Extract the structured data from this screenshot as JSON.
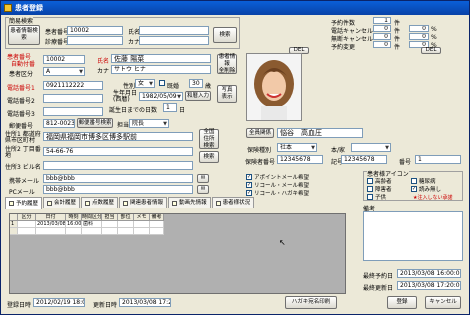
{
  "window": {
    "title": "患者登録"
  },
  "search": {
    "group_label": "簡易検索",
    "button": "患者情報検索",
    "no_label": "患者番号",
    "no_value": "10002",
    "card_label": "診療番号",
    "card_value": "",
    "name_label": "氏名",
    "name_value": "",
    "kana_label": "カナ",
    "kana_value": "",
    "search_btn": "検索"
  },
  "stats": {
    "rows": [
      {
        "label": "予約件数",
        "count": "1",
        "unit": "件"
      },
      {
        "label": "電話キャンセル",
        "count": "0",
        "unit": "件",
        "pct": "0",
        "pct_unit": "%"
      },
      {
        "label": "無断キャンセル",
        "count": "0",
        "unit": "件",
        "pct": "0",
        "pct_unit": "%"
      },
      {
        "label": "予約変更",
        "count": "0",
        "unit": "件",
        "pct": "0",
        "pct_unit": "%"
      }
    ],
    "del1": "DEL",
    "del2": "DEL"
  },
  "patient": {
    "no_label": "患者番号",
    "no_sub": "自動付番",
    "no_value": "10002",
    "div_label": "患者区分",
    "div_value": "A",
    "tel1_label": "電話番号1",
    "tel1_value": "0921112222",
    "tel2_label": "電話番号2",
    "tel2_value": "",
    "tel3_label": "電話番号3",
    "tel3_value": "",
    "zip_label": "郵便番号",
    "zip_value": "812-0023",
    "zip_btn": "郵便番号検索",
    "addr1_label": "住所1 都道府県市区町村",
    "addr1_value": "福岡県福岡市博多区博多駅前",
    "addr2_label": "住所2 丁目番地",
    "addr2_value": "54-66-76",
    "addr3_label": "住所3 ビル名",
    "addr3_value": "",
    "mobile_label": "携帯メール",
    "mobile_value": "bbb@bbb",
    "pc_label": "PCメール",
    "pc_value": "bbb@bbb",
    "name_label": "氏名",
    "name_value": "佐藤 陽菜",
    "kana_label": "カナ",
    "kana_value": "サトウ ヒナ",
    "sex_label": "性別",
    "sex_value": "女",
    "married_label": "既婚",
    "married_value": "",
    "age_value": "30",
    "age_unit": "歳",
    "birth_label": "生年月日 (西暦)",
    "birth_value": "1982/05/09",
    "birth_btn": "和暦入力",
    "days_label": "誕生日までの日数",
    "days_value": "1",
    "days_unit": "日",
    "ref_label": "担当",
    "ref_value": "院長",
    "info_btn": "患者情報\n全削除",
    "photo_btn": "写真\n表示",
    "addr_btn1": "全国\n住所\n検索",
    "addr_btn2": "検索"
  },
  "insurance": {
    "family_btn": "全員関係",
    "family_value": "悩谷　高血圧",
    "type_label": "保険種別",
    "type_value": "社本",
    "cat_label": "本/家",
    "cat_value": "",
    "num_label": "保険者番号",
    "num_value": "12345678",
    "sym_label": "記号",
    "sym_value": "12345678",
    "no_label": "番号",
    "no_value": "1"
  },
  "checks": [
    {
      "label": "アポイントメール希望",
      "checked": true
    },
    {
      "label": "リコール・メール希望",
      "checked": true
    },
    {
      "label": "リコール・ハガキ希望",
      "checked": true
    }
  ],
  "icons": {
    "label": "患者様アイコン",
    "items": [
      {
        "label": "高齢者",
        "checked": false
      },
      {
        "label": "糖尿病",
        "checked": false
      },
      {
        "label": "障害者",
        "checked": false
      },
      {
        "label": "読み無し",
        "checked": true
      },
      {
        "label": "子供",
        "checked": false
      }
    ]
  },
  "notes": {
    "label": "備考",
    "value": "",
    "warn": "★注入しない承諾"
  },
  "tabs": [
    "予約履歴",
    "会計履歴",
    "点数履歴",
    "関連患者情報",
    "動画先情報",
    "患者様状況"
  ],
  "grid": {
    "headers": [
      "",
      "区分",
      "日付",
      "時刻",
      "時間区分",
      "担当",
      "部位",
      "メモ",
      "備考"
    ],
    "rows": [
      [
        "1",
        "",
        "2013/03/08",
        "16:00",
        "歯科",
        "",
        "",
        "",
        ""
      ],
      [
        "",
        "",
        "",
        "",
        "",
        "",
        "",
        "",
        ""
      ]
    ]
  },
  "last": {
    "appt_label": "最終予約日",
    "appt_value": "2013/03/08 16:00:00",
    "update_label": "最終更新日",
    "update_value": "2013/03/08 17:20:03"
  },
  "footer": {
    "reg_label": "登録日時",
    "reg_value": "2012/02/19 18:05",
    "upd_label": "更新日時",
    "upd_value": "2013/03/08 17:20:03",
    "print_btn": "ハガキ宛名印刷",
    "save_btn": "登録",
    "cancel_btn": "キャンセル"
  }
}
